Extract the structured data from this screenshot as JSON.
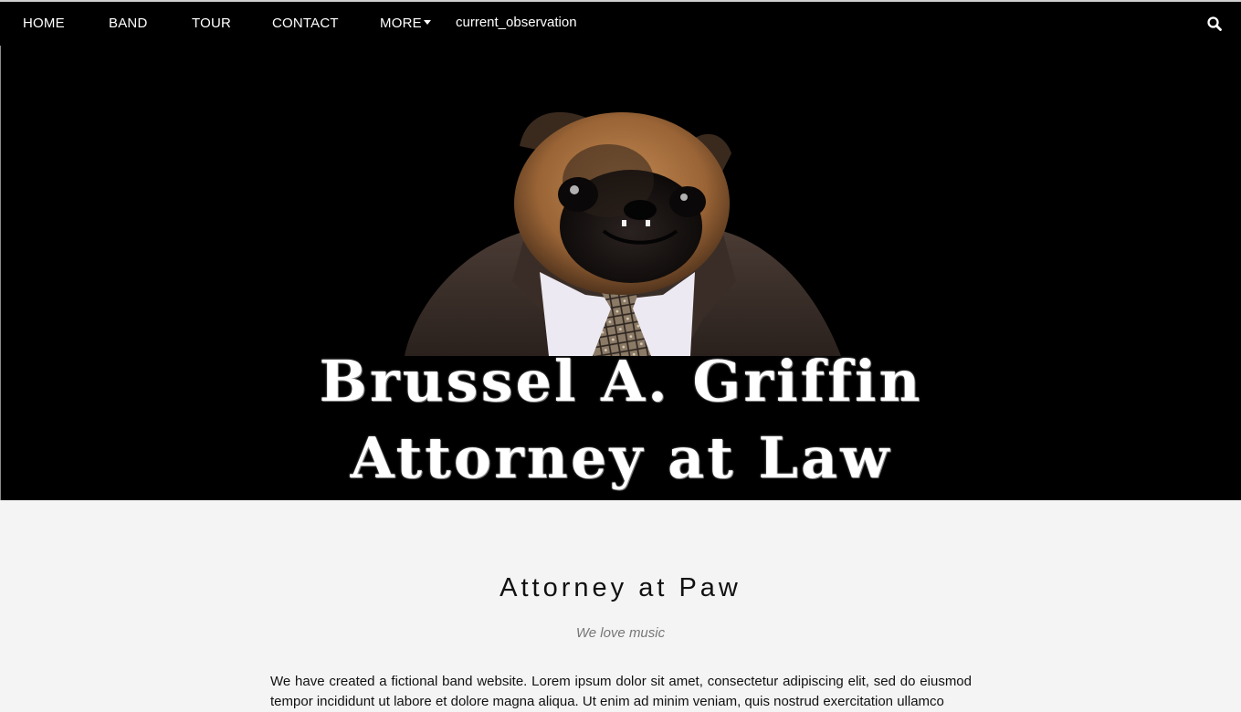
{
  "nav": {
    "items": [
      "HOME",
      "BAND",
      "TOUR",
      "CONTACT",
      "MORE"
    ],
    "extra_label": "current_observation",
    "search_icon": "search-icon"
  },
  "hero": {
    "image_subject": "pug dog wearing a suit and tie",
    "title_line_1": "Brussel A. Griffin",
    "title_line_2": "Attorney at Law"
  },
  "section": {
    "title": "Attorney at Paw",
    "subtitle": "We love music",
    "body": "We have created a fictional band website. Lorem ipsum dolor sit amet, consectetur adipiscing elit, sed do eiusmod tempor incididunt ut labore et dolore magna aliqua. Ut enim ad minim veniam, quis nostrud exercitation ullamco"
  },
  "colors": {
    "nav_bg": "#000000",
    "hero_bg": "#000000",
    "content_bg": "#f4f4f4",
    "text": "#111111",
    "subtitle": "#777777"
  }
}
